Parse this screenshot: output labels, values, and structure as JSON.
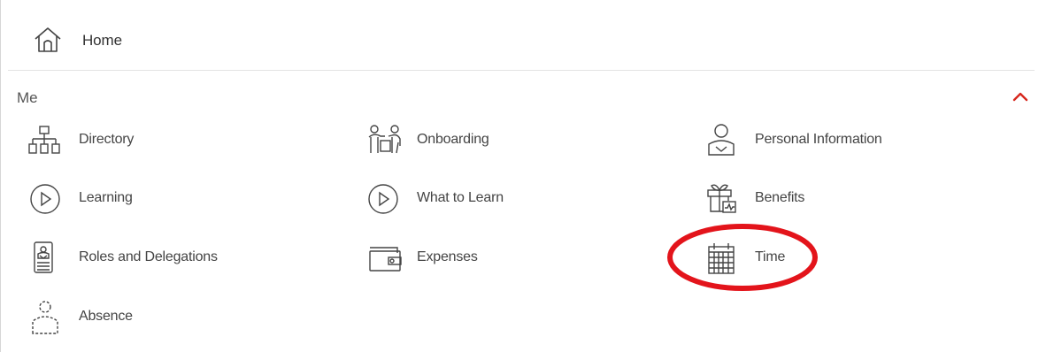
{
  "nav": {
    "home_label": "Home"
  },
  "section": {
    "title": "Me",
    "collapse_icon": "chevron-up-icon",
    "accent_color": "#d7281e"
  },
  "items": [
    {
      "label": "Directory",
      "icon": "org-chart-icon"
    },
    {
      "label": "Onboarding",
      "icon": "onboarding-people-icon"
    },
    {
      "label": "Personal Information",
      "icon": "person-badge-icon"
    },
    {
      "label": "Learning",
      "icon": "play-circle-icon"
    },
    {
      "label": "What to Learn",
      "icon": "play-circle-icon"
    },
    {
      "label": "Benefits",
      "icon": "gift-icon"
    },
    {
      "label": "Roles and Delegations",
      "icon": "id-badge-icon"
    },
    {
      "label": "Expenses",
      "icon": "wallet-icon"
    },
    {
      "label": "Time",
      "icon": "calendar-icon"
    },
    {
      "label": "Absence",
      "icon": "absence-person-icon"
    }
  ],
  "annotation": {
    "color": "#e3141b",
    "target": "Time"
  }
}
